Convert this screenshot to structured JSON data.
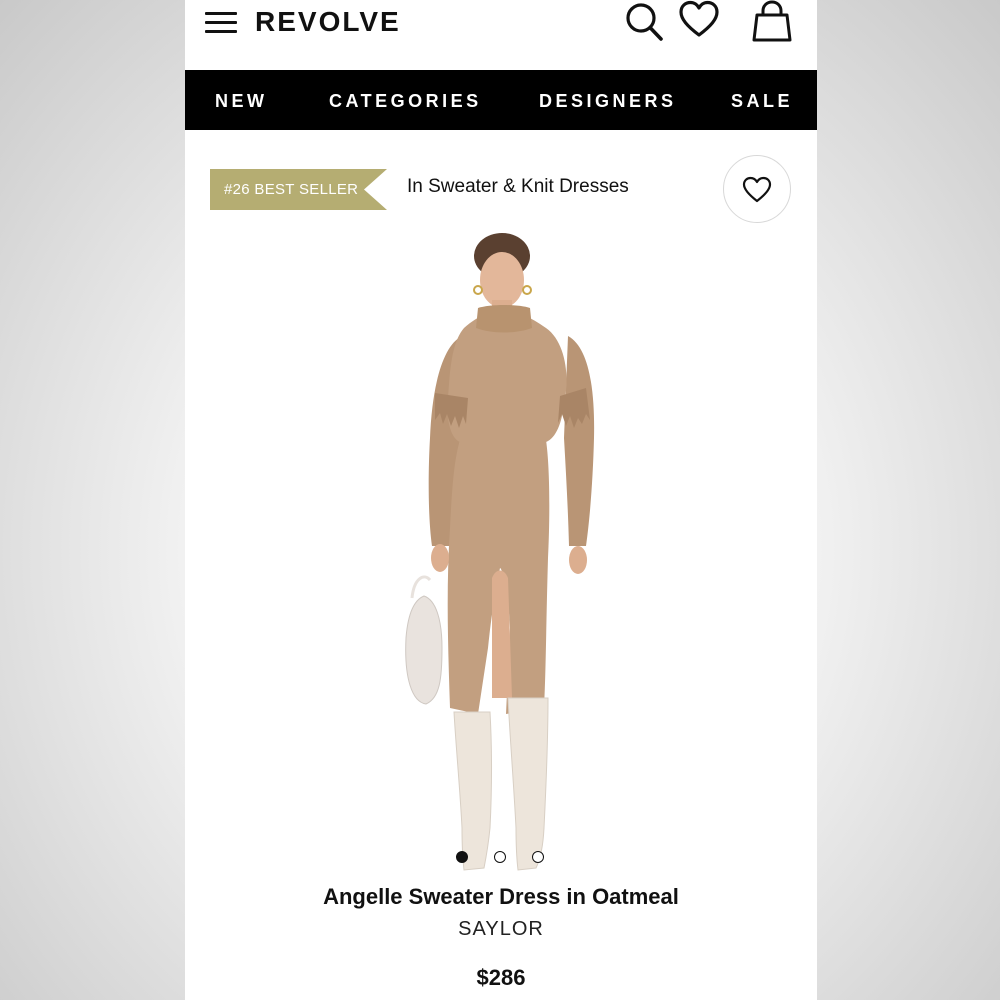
{
  "header": {
    "logo": "REVOLVE",
    "icons": [
      "menu-icon",
      "search-icon",
      "heart-icon",
      "shopping-bag-icon"
    ]
  },
  "nav": {
    "items": [
      "NEW",
      "CATEGORIES",
      "DESIGNERS",
      "SALE"
    ]
  },
  "badge": {
    "ribbon_text": "#26 BEST SELLER",
    "category_text": "In Sweater & Knit Dresses",
    "ribbon_color": "#b5ad72"
  },
  "gallery": {
    "image_count": 3,
    "active_index": 0
  },
  "product": {
    "name": "Angelle Sweater Dress in Oatmeal",
    "brand": "SAYLOR",
    "price": "$286"
  },
  "colors": {
    "nav_background": "#000000",
    "dress": "#c29f80",
    "boots": "#ede5db"
  }
}
